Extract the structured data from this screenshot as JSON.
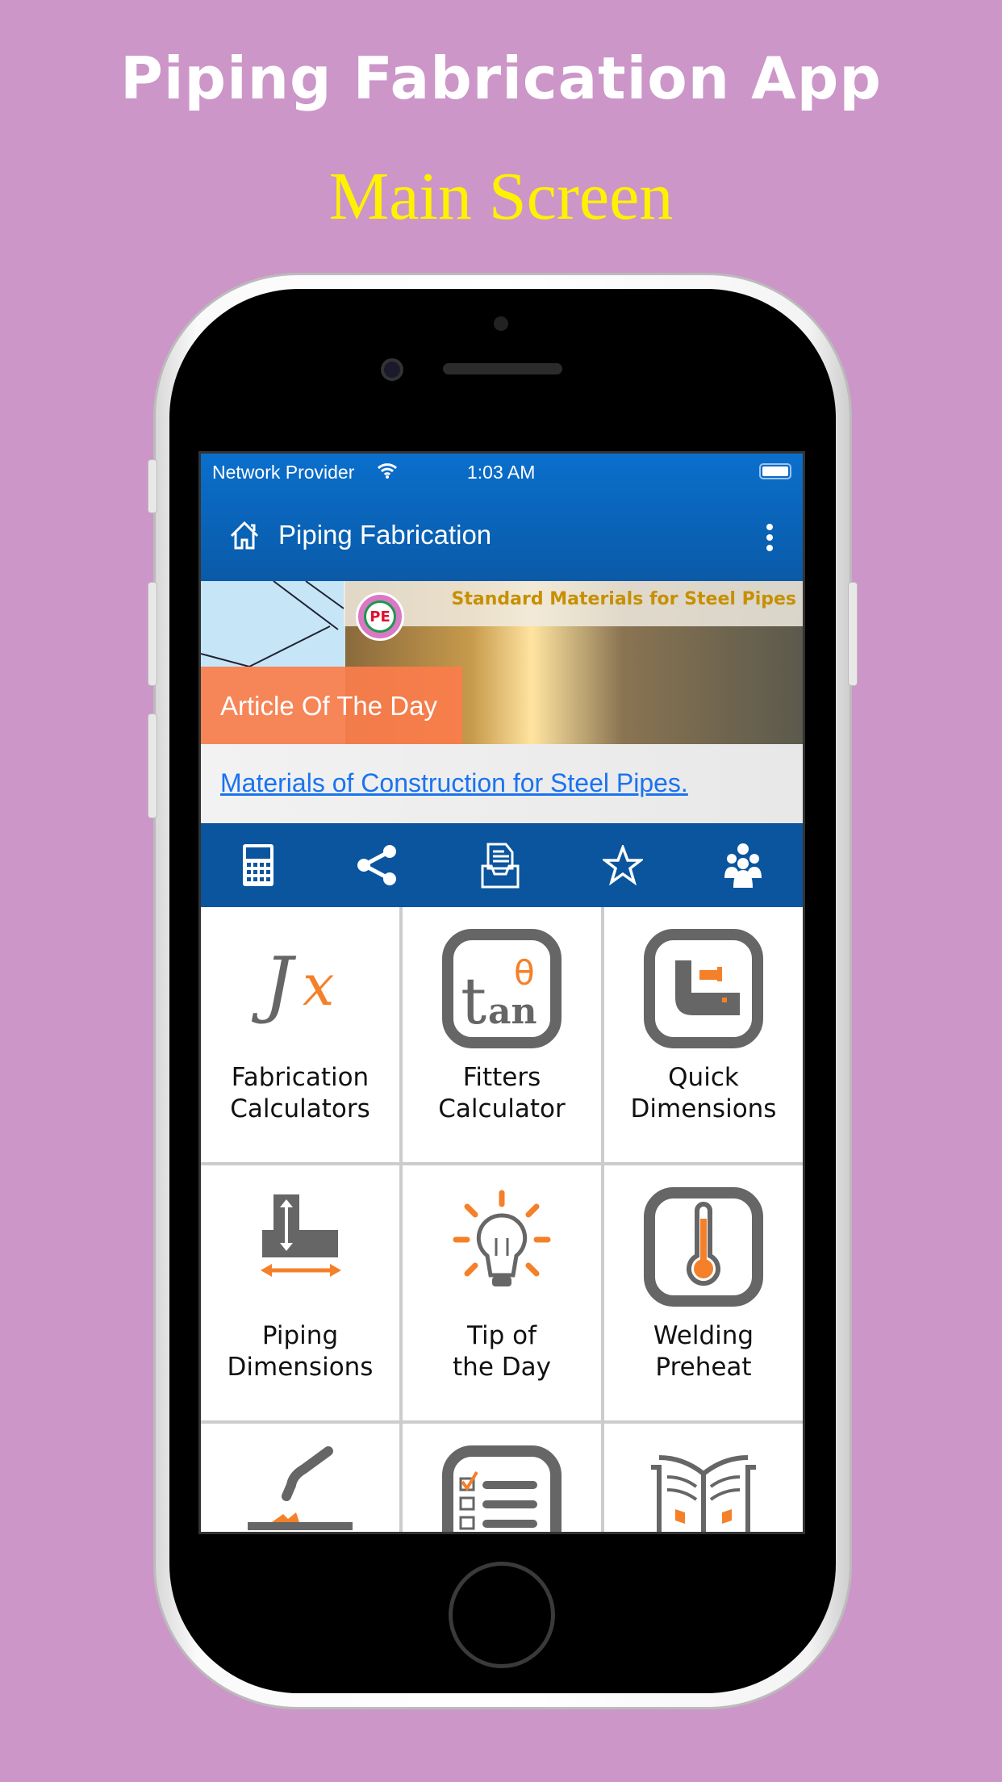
{
  "promo": {
    "title": "Piping Fabrication App",
    "subtitle": "Main Screen"
  },
  "status_bar": {
    "provider": "Network Provider",
    "time": "1:03 AM"
  },
  "app_bar": {
    "title": "Piping Fabrication"
  },
  "banner": {
    "heading": "Standard Materials for Steel Pipes",
    "logo": "PE",
    "label": "Article Of The Day"
  },
  "article_link": "Materials of Construction for Steel Pipes.",
  "icon_bar": [
    "calculator-icon",
    "share-icon",
    "inbox-icon",
    "star-icon",
    "community-icon"
  ],
  "colors": {
    "app_bar": "#0a5aa8",
    "icon_bar": "#0a559e",
    "accent": "#f5802a",
    "icon_gray": "#666666",
    "link": "#1a73f0",
    "background": "#cc96c8"
  },
  "grid": [
    {
      "label": "Fabrication\nCalculators",
      "icon": "fx-icon"
    },
    {
      "label": "Fitters\nCalculator",
      "icon": "tan-icon"
    },
    {
      "label": "Quick\nDimensions",
      "icon": "quick-dimensions-icon"
    },
    {
      "label": "Piping\nDimensions",
      "icon": "piping-dimensions-icon"
    },
    {
      "label": "Tip of\nthe Day",
      "icon": "lightbulb-icon"
    },
    {
      "label": "Welding\nPreheat",
      "icon": "thermometer-icon"
    },
    {
      "label": "",
      "icon": "welding-torch-icon"
    },
    {
      "label": "",
      "icon": "checklist-icon"
    },
    {
      "label": "",
      "icon": "book-icon"
    }
  ]
}
